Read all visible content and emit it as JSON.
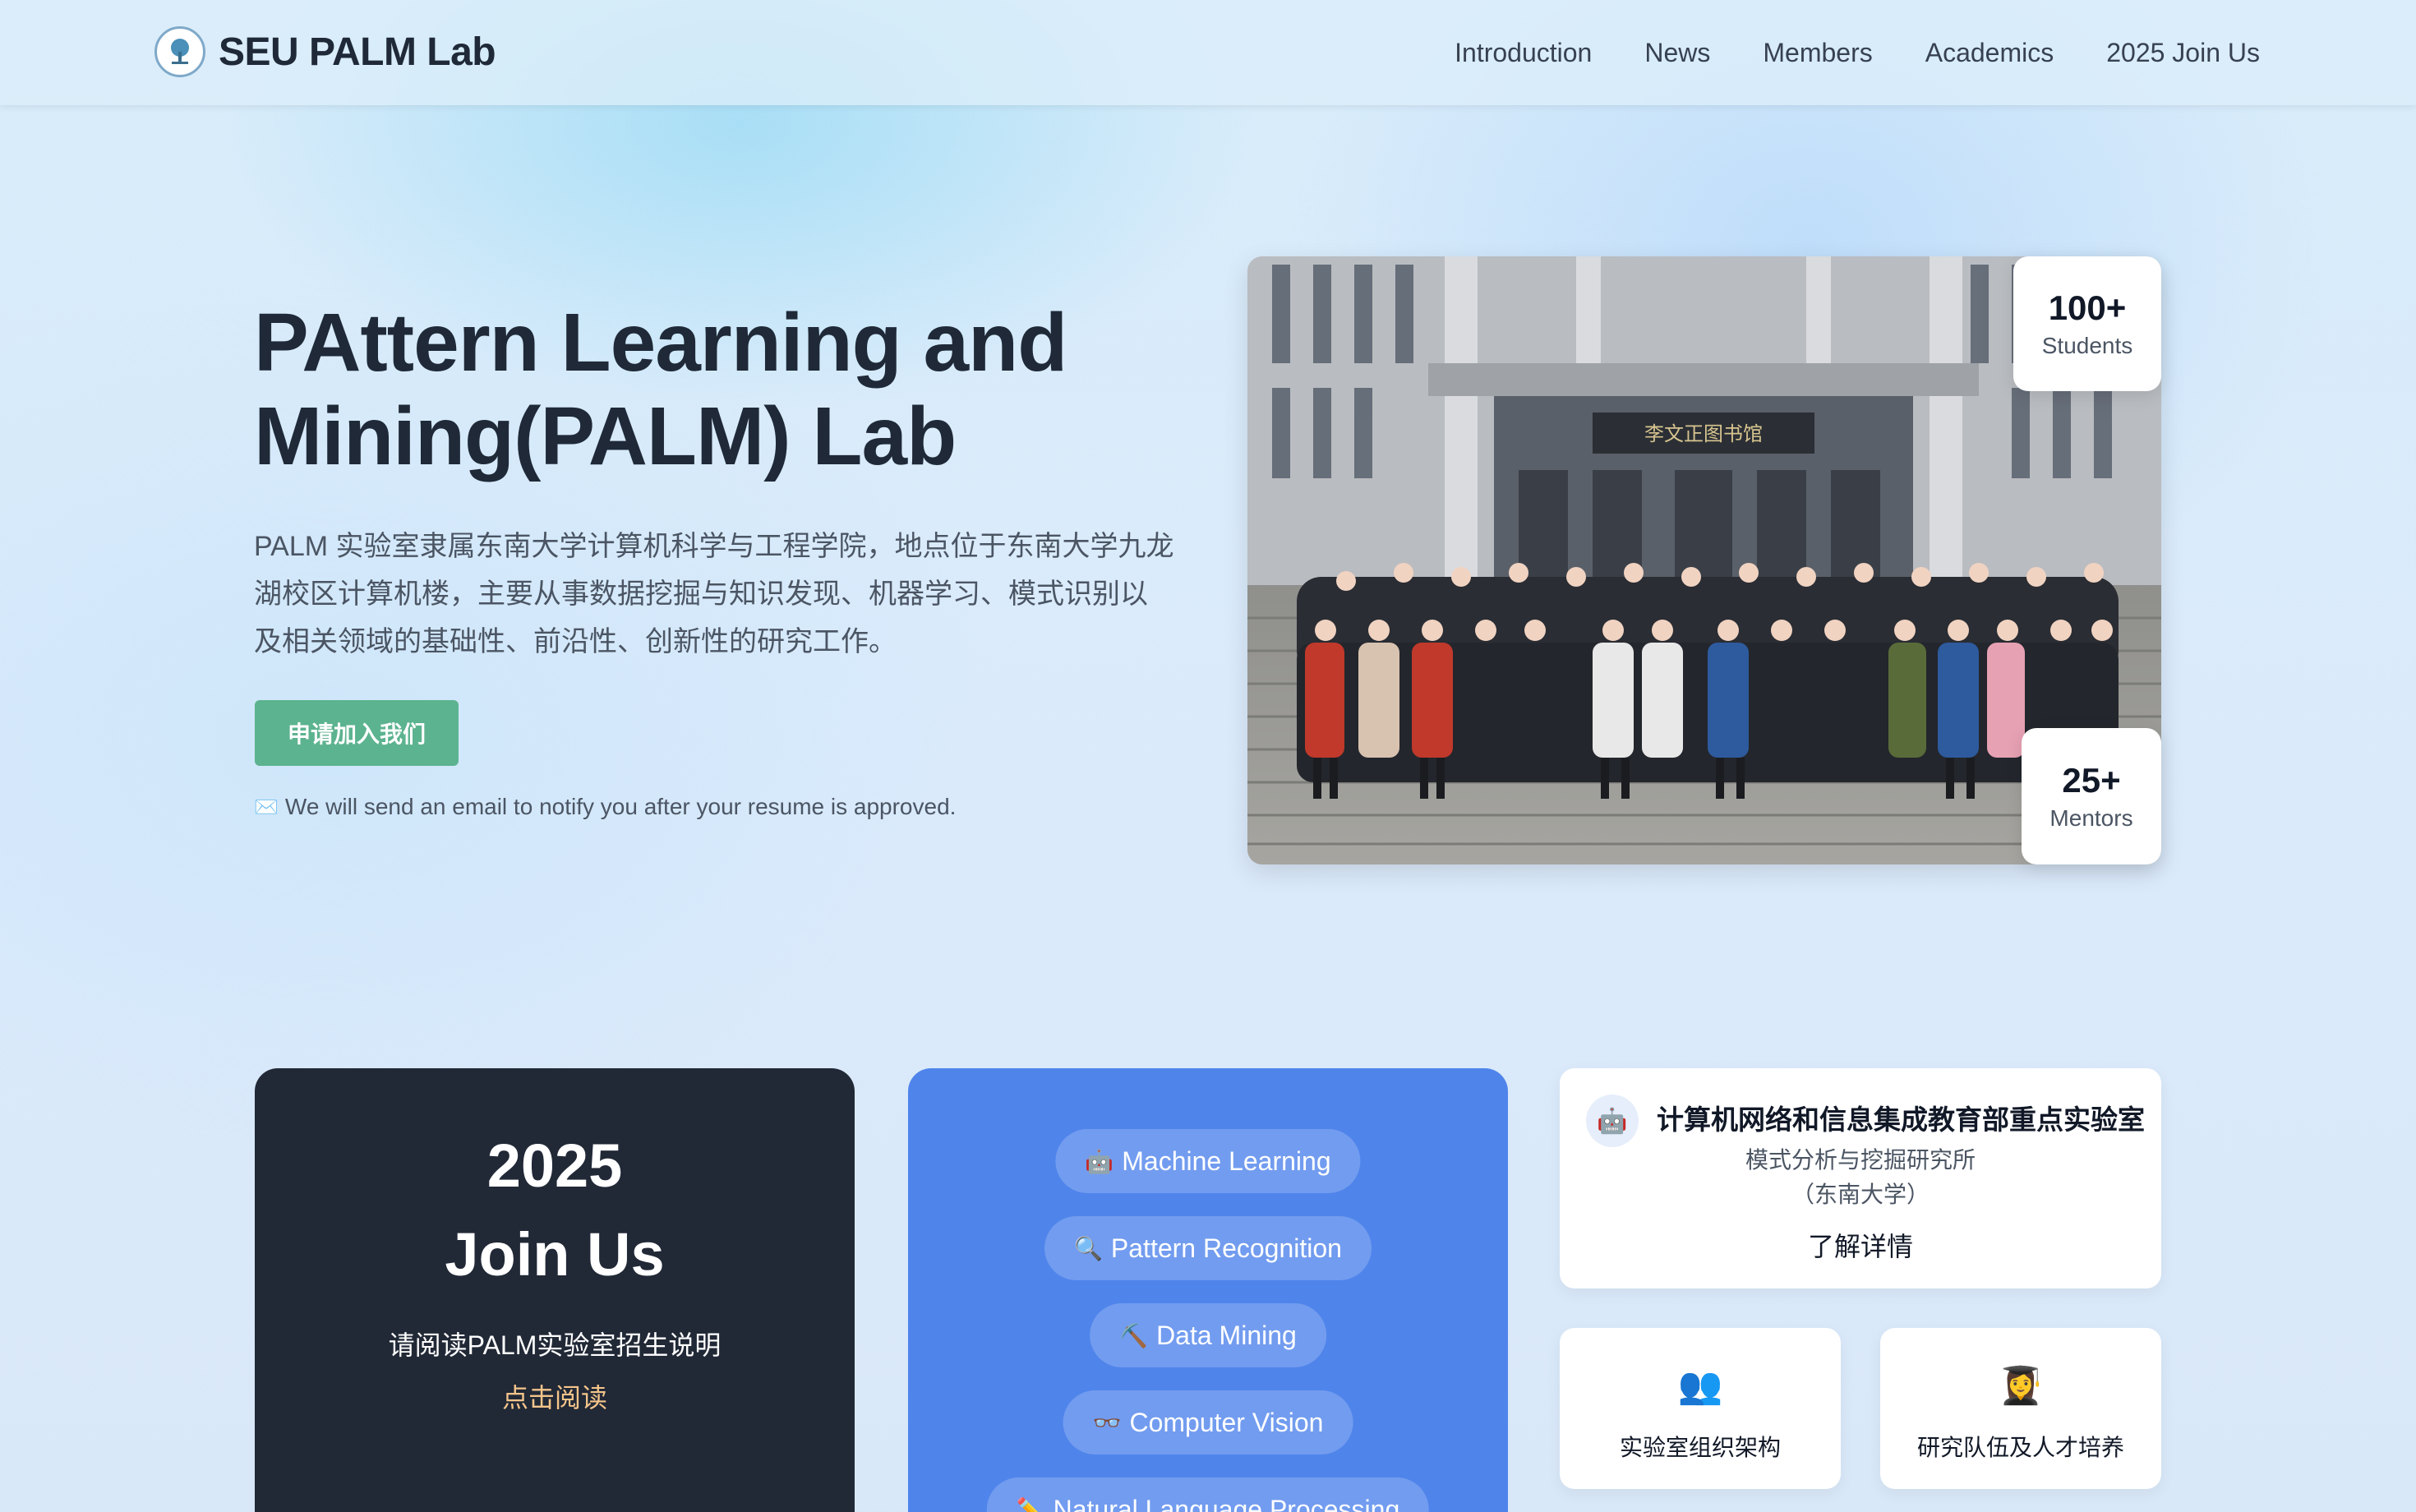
{
  "nav": {
    "brand": "SEU PALM Lab",
    "links": [
      "Introduction",
      "News",
      "Members",
      "Academics",
      "2025 Join Us"
    ]
  },
  "hero": {
    "title_line1": "PAttern Learning and",
    "title_line2": "Mining(PALM) Lab",
    "description": "PALM 实验室隶属东南大学计算机科学与工程学院，地点位于东南大学九龙湖校区计算机楼，主要从事数据挖掘与知识发现、机器学习、模式识别以及相关领域的基础性、前沿性、创新性的研究工作。",
    "apply_button": "申请加入我们",
    "notice": "We will send an email to notify you after your resume is approved.",
    "notice_icon": "✉️"
  },
  "photo": {
    "building_sign": "李文正图书馆"
  },
  "stats": {
    "students_value": "100+",
    "students_label": "Students",
    "mentors_value": "25+",
    "mentors_label": "Mentors"
  },
  "join_card": {
    "year": "2025",
    "title": "Join Us",
    "read_text": "请阅读PALM实验室招生说明",
    "click_text": "点击阅读"
  },
  "research": {
    "areas": [
      {
        "icon": "🤖",
        "label": "Machine Learning"
      },
      {
        "icon": "🔍",
        "label": "Pattern Recognition"
      },
      {
        "icon": "⛏️",
        "label": "Data Mining"
      },
      {
        "icon": "👓",
        "label": "Computer Vision"
      },
      {
        "icon": "✏️",
        "label": "Natural Language Processing"
      }
    ]
  },
  "lab_card": {
    "icon": "🤖",
    "title": "计算机网络和信息集成教育部重点实验室",
    "sub1": "模式分析与挖掘研究所",
    "sub2": "（东南大学）",
    "more": "了解详情"
  },
  "small_cards": [
    {
      "icon": "👥",
      "label": "实验室组织架构"
    },
    {
      "icon": "👩‍🎓",
      "label": "研究队伍及人才培养"
    }
  ],
  "colors": {
    "accent_green": "#5cb38f",
    "dark_card": "#212836",
    "blue_card": "#4f84eb",
    "link_gold": "#f4c58a"
  }
}
